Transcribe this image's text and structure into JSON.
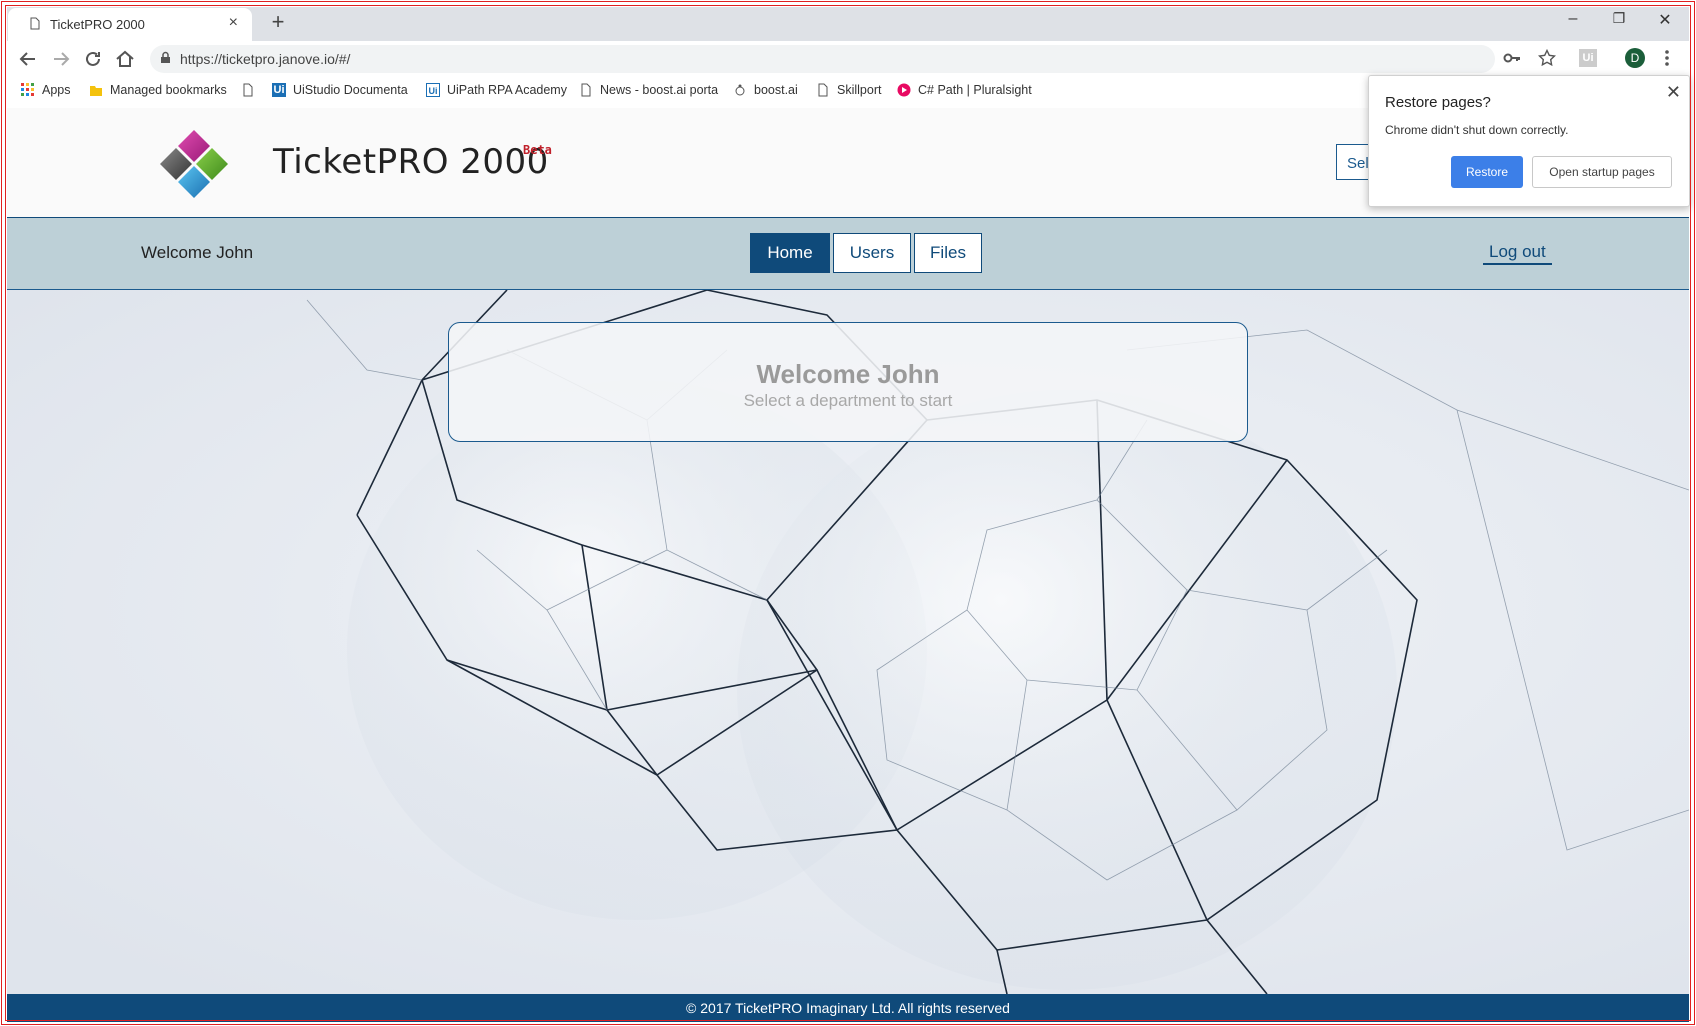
{
  "browser": {
    "tab_title": "TicketPRO 2000",
    "tab_close": "×",
    "new_tab": "+",
    "url": "https://ticketpro.janove.io/#/",
    "profile_initial": "D",
    "window_controls": {
      "minimize": "–",
      "restore": "❐",
      "close": "✕"
    },
    "toolbar_icons": [
      "back-icon",
      "forward-icon",
      "reload-icon",
      "home-icon",
      "key-icon",
      "star-icon",
      "extension-icon",
      "menu-icon"
    ],
    "bookmarks": [
      {
        "label": "Apps",
        "icon": "apps-grid-icon"
      },
      {
        "label": "Managed bookmarks",
        "icon": "folder-icon"
      },
      {
        "label": "",
        "icon": "page-icon"
      },
      {
        "label": "UiStudio Documenta",
        "icon": "uipath-icon"
      },
      {
        "label": "UiPath RPA Academy",
        "icon": "uipath-outline-icon"
      },
      {
        "label": "News - boost.ai porta",
        "icon": "page-icon"
      },
      {
        "label": "boost.ai",
        "icon": "boost-icon"
      },
      {
        "label": "Skillport",
        "icon": "page-icon"
      },
      {
        "label": "C# Path | Pluralsight",
        "icon": "pluralsight-icon"
      }
    ]
  },
  "restore_popup": {
    "title": "Restore pages?",
    "message": "Chrome didn't shut down correctly.",
    "restore_label": "Restore",
    "startup_label": "Open startup pages",
    "close": "✕"
  },
  "header": {
    "brand_name": "TicketPRO 2000",
    "brand_tag": "Beta",
    "dept_select_partial": "Sel"
  },
  "nav": {
    "welcome": "Welcome John",
    "tabs": [
      {
        "label": "Home",
        "active": true
      },
      {
        "label": "Users",
        "active": false
      },
      {
        "label": "Files",
        "active": false
      }
    ],
    "logout": "Log out"
  },
  "main": {
    "card_title": "Welcome John",
    "card_subtitle": "Select a department to start"
  },
  "footer": {
    "text": "© 2017 TicketPRO Imaginary Ltd. All rights reserved"
  },
  "colors": {
    "brand_blue": "#0f4a7a",
    "nav_bg": "#bdd0d7",
    "beta_red": "#c0202a",
    "chrome_blue": "#3c7fe8"
  }
}
